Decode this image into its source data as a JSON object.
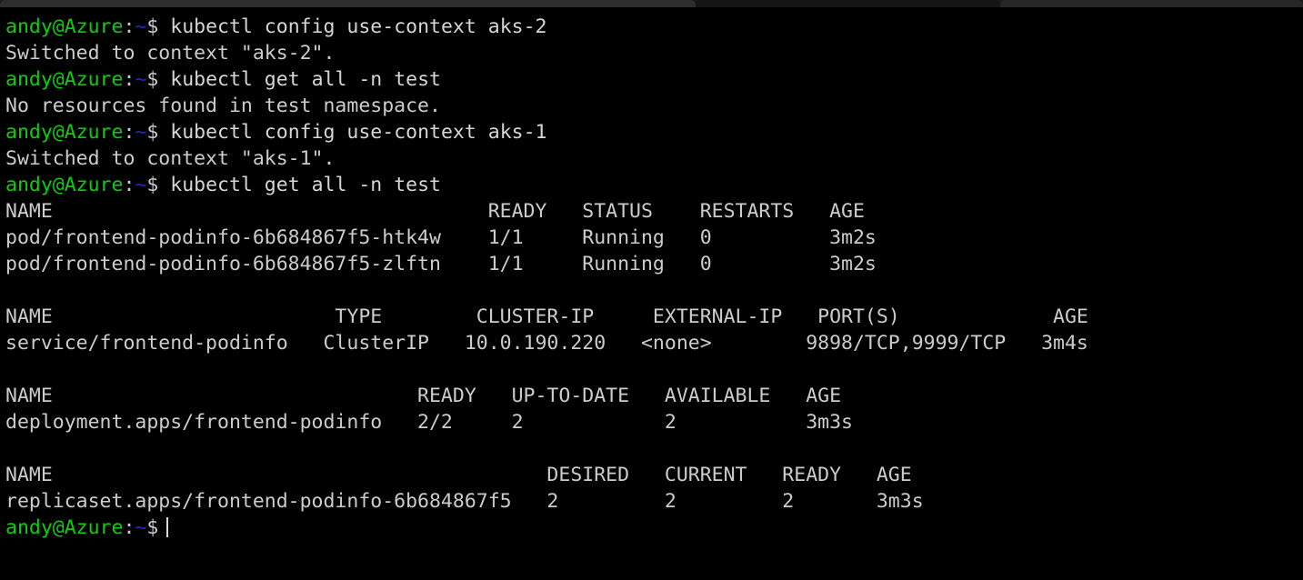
{
  "window": {
    "titlebar": {
      "active_tab_label": "",
      "inactive_tab_label": ""
    }
  },
  "terminal": {
    "colors": {
      "background": "#000000",
      "foreground": "#cccccc",
      "prompt_user_host": "#0ecb0e",
      "prompt_path": "#2222cc",
      "prompt_symbol": "#cccccc",
      "caret": "#dddddd"
    },
    "prompt": {
      "user_host": "andy@Azure",
      "colon": ":",
      "path": "~",
      "symbol": "$"
    },
    "lines": [
      {
        "type": "prompt",
        "command": " kubectl config use-context aks-2"
      },
      {
        "type": "output",
        "text": "Switched to context \"aks-2\"."
      },
      {
        "type": "prompt",
        "command": " kubectl get all -n test"
      },
      {
        "type": "output",
        "text": "No resources found in test namespace."
      },
      {
        "type": "prompt",
        "command": " kubectl config use-context aks-1"
      },
      {
        "type": "output",
        "text": "Switched to context \"aks-1\"."
      },
      {
        "type": "prompt",
        "command": " kubectl get all -n test"
      },
      {
        "type": "output",
        "text": "NAME                                     READY   STATUS    RESTARTS   AGE"
      },
      {
        "type": "output",
        "text": "pod/frontend-podinfo-6b684867f5-htk4w    1/1     Running   0          3m2s"
      },
      {
        "type": "output",
        "text": "pod/frontend-podinfo-6b684867f5-zlftn    1/1     Running   0          3m2s"
      },
      {
        "type": "blank",
        "text": ""
      },
      {
        "type": "output",
        "text": "NAME                        TYPE        CLUSTER-IP     EXTERNAL-IP   PORT(S)             AGE"
      },
      {
        "type": "output",
        "text": "service/frontend-podinfo   ClusterIP   10.0.190.220   <none>        9898/TCP,9999/TCP   3m4s"
      },
      {
        "type": "blank",
        "text": ""
      },
      {
        "type": "output",
        "text": "NAME                               READY   UP-TO-DATE   AVAILABLE   AGE"
      },
      {
        "type": "output",
        "text": "deployment.apps/frontend-podinfo   2/2     2            2           3m3s"
      },
      {
        "type": "blank",
        "text": ""
      },
      {
        "type": "output",
        "text": "NAME                                          DESIRED   CURRENT   READY   AGE"
      },
      {
        "type": "output",
        "text": "replicaset.apps/frontend-podinfo-6b684867f5   2         2         2       3m3s"
      },
      {
        "type": "prompt_caret",
        "command": ""
      }
    ],
    "kubectl_tables": {
      "pods": {
        "headers": [
          "NAME",
          "READY",
          "STATUS",
          "RESTARTS",
          "AGE"
        ],
        "rows": [
          [
            "pod/frontend-podinfo-6b684867f5-htk4w",
            "1/1",
            "Running",
            "0",
            "3m2s"
          ],
          [
            "pod/frontend-podinfo-6b684867f5-zlftn",
            "1/1",
            "Running",
            "0",
            "3m2s"
          ]
        ]
      },
      "services": {
        "headers": [
          "NAME",
          "TYPE",
          "CLUSTER-IP",
          "EXTERNAL-IP",
          "PORT(S)",
          "AGE"
        ],
        "rows": [
          [
            "service/frontend-podinfo",
            "ClusterIP",
            "10.0.190.220",
            "<none>",
            "9898/TCP,9999/TCP",
            "3m4s"
          ]
        ]
      },
      "deployments": {
        "headers": [
          "NAME",
          "READY",
          "UP-TO-DATE",
          "AVAILABLE",
          "AGE"
        ],
        "rows": [
          [
            "deployment.apps/frontend-podinfo",
            "2/2",
            "2",
            "2",
            "3m3s"
          ]
        ]
      },
      "replicasets": {
        "headers": [
          "NAME",
          "DESIRED",
          "CURRENT",
          "READY",
          "AGE"
        ],
        "rows": [
          [
            "replicaset.apps/frontend-podinfo-6b684867f5",
            "2",
            "2",
            "2",
            "3m3s"
          ]
        ]
      }
    }
  }
}
